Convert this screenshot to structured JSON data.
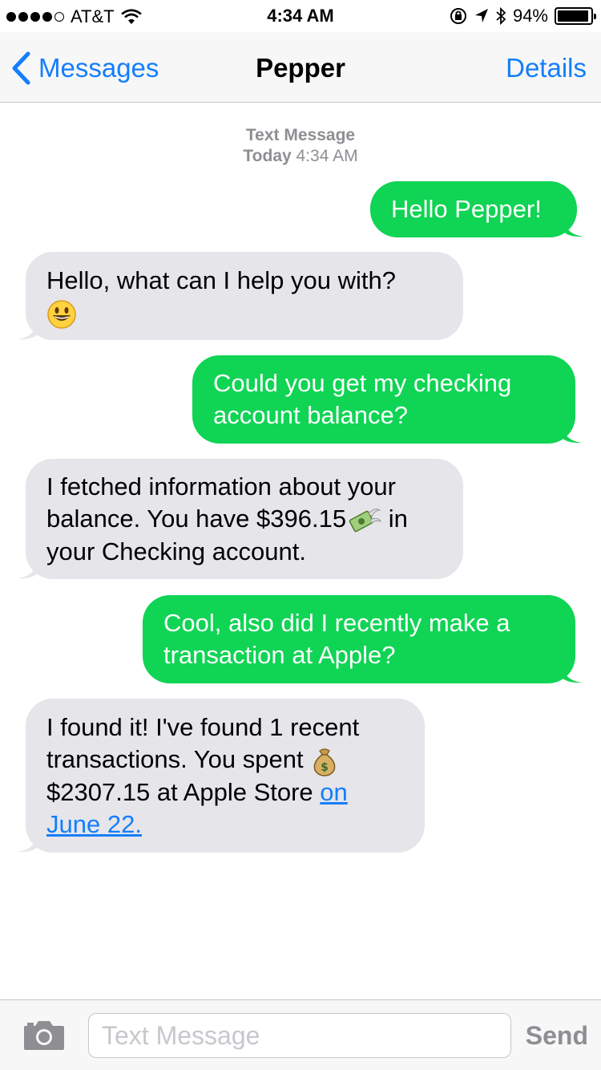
{
  "status_bar": {
    "carrier": "AT&T",
    "time": "4:34 AM",
    "battery_pct": "94%",
    "battery_level": 0.94,
    "icons": [
      "signal-dots-icon",
      "wifi-icon",
      "orientation-lock-icon",
      "location-icon",
      "bluetooth-icon",
      "battery-icon"
    ]
  },
  "nav": {
    "back_label": "Messages",
    "title": "Pepper",
    "details_label": "Details"
  },
  "timestamp": {
    "line1": "Text Message",
    "day": "Today",
    "time": "4:34 AM"
  },
  "messages": [
    {
      "from": "me",
      "text": "Hello Pepper!"
    },
    {
      "from": "them",
      "line1": "Hello, what can I help you with?",
      "emoji": "smiley-emoji"
    },
    {
      "from": "me",
      "line1": "Could you get my checking",
      "line2": "account balance?"
    },
    {
      "from": "them",
      "line1": "I fetched information about your",
      "line2a": "balance. You have $396.15",
      "line2b": " in",
      "line3": "your Checking account.",
      "emoji": "money-with-wings-emoji"
    },
    {
      "from": "me",
      "line1": "Cool, also did I recently make a",
      "line2": "transaction at Apple?"
    },
    {
      "from": "them",
      "line1": "I found it! I've found 1 recent",
      "line2": "transactions. You spent ",
      "line3a": "$2307.15 at Apple Store ",
      "link1": "on",
      "link2": "June 22.",
      "emoji": "money-bag-emoji"
    }
  ],
  "input": {
    "placeholder": "Text Message",
    "send_label": "Send"
  },
  "colors": {
    "accent": "#147efb",
    "sent_bubble": "#0fd454",
    "received_bubble": "#e5e5ea"
  }
}
